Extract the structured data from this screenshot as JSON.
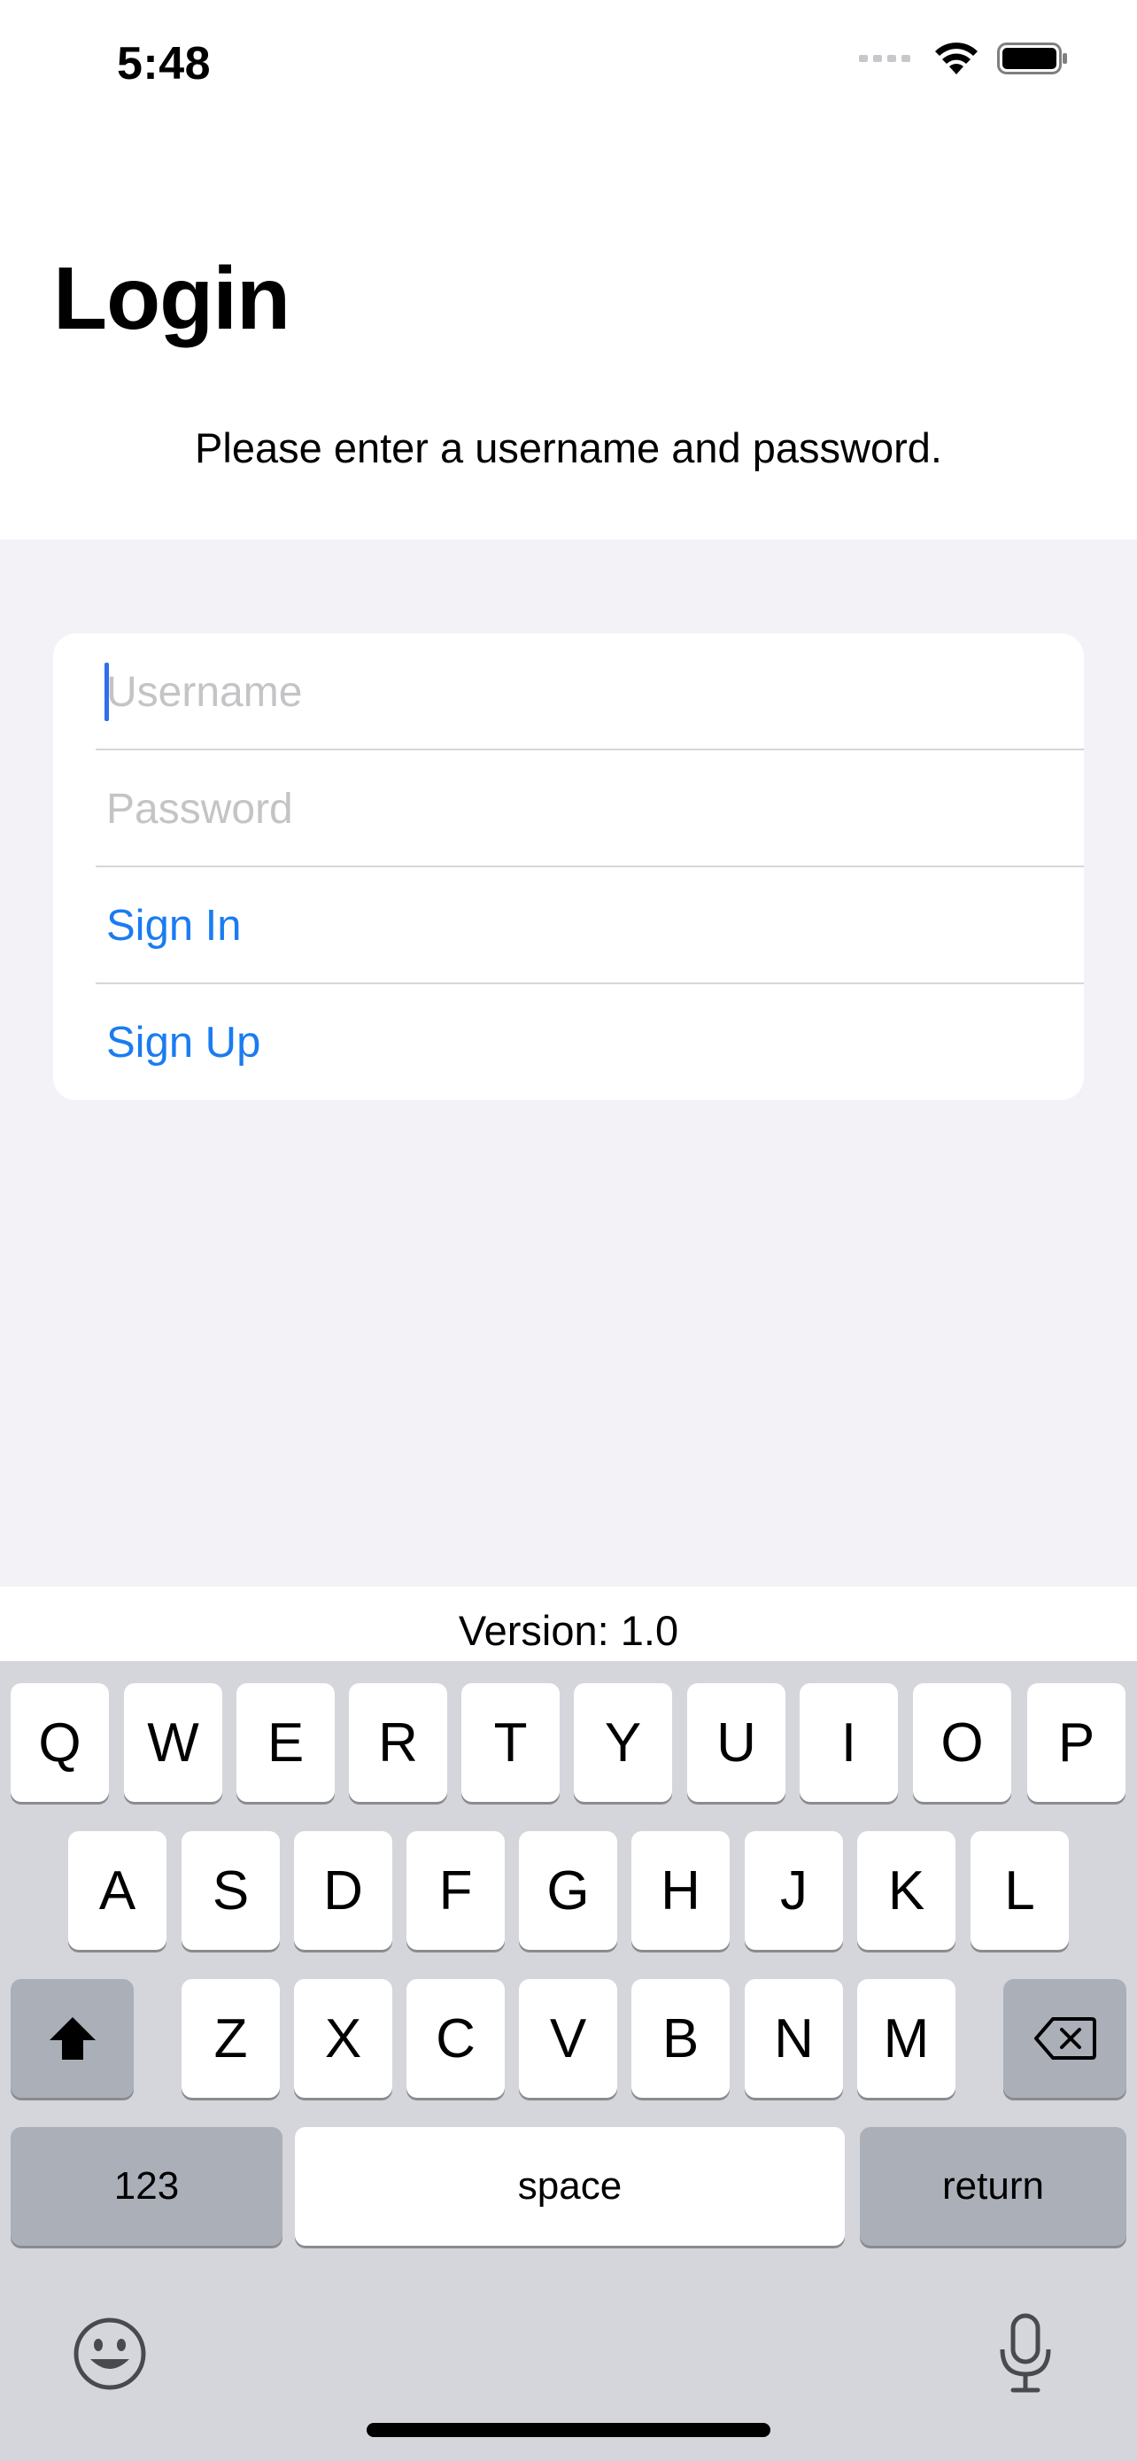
{
  "status_bar": {
    "time": "5:48",
    "icons": [
      "cellular-signal-icon",
      "wifi-icon",
      "battery-icon"
    ]
  },
  "header": {
    "title": "Login",
    "subtitle": "Please enter a username and password."
  },
  "form": {
    "username_placeholder": "Username",
    "username_value": "",
    "password_placeholder": "Password",
    "password_value": "",
    "sign_in_label": "Sign In",
    "sign_up_label": "Sign Up"
  },
  "footer": {
    "version": "Version: 1.0"
  },
  "keyboard": {
    "row1": [
      "Q",
      "W",
      "E",
      "R",
      "T",
      "Y",
      "U",
      "I",
      "O",
      "P"
    ],
    "row2": [
      "A",
      "S",
      "D",
      "F",
      "G",
      "H",
      "J",
      "K",
      "L"
    ],
    "row3": [
      "Z",
      "X",
      "C",
      "V",
      "B",
      "N",
      "M"
    ],
    "numbers_label": "123",
    "space_label": "space",
    "return_label": "return",
    "icons": [
      "shift-icon",
      "backspace-icon",
      "emoji-icon",
      "microphone-icon"
    ]
  },
  "colors": {
    "accent": "#1a7cf0",
    "grouped_background": "#f2f2f7",
    "keyboard_background": "#d5d6db",
    "special_key": "#abafb8"
  }
}
